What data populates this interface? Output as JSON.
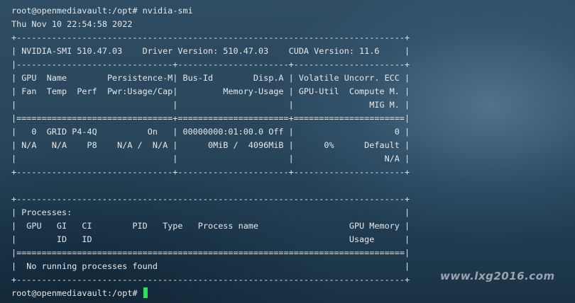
{
  "terminal": {
    "lines": [
      "root@openmediavault:/opt# nvidia-smi",
      "Thu Nov 10 22:54:58 2022",
      "+-----------------------------------------------------------------------------+",
      "| NVIDIA-SMI 510.47.03    Driver Version: 510.47.03    CUDA Version: 11.6     |",
      "|-------------------------------+----------------------+----------------------+",
      "| GPU  Name        Persistence-M| Bus-Id        Disp.A | Volatile Uncorr. ECC |",
      "| Fan  Temp  Perf  Pwr:Usage/Cap|         Memory-Usage | GPU-Util  Compute M. |",
      "|                               |                      |               MIG M. |",
      "|===============================+======================+======================|",
      "|   0  GRID P4-4Q          On   | 00000000:01:00.0 Off |                    0 |",
      "| N/A   N/A    P8    N/A /  N/A |      0MiB /  4096MiB |      0%      Default |",
      "|                               |                      |                  N/A |",
      "+-------------------------------+----------------------+----------------------+",
      "",
      "+-----------------------------------------------------------------------------+",
      "| Processes:                                                                  |",
      "|  GPU   GI   CI        PID   Type   Process name                  GPU Memory |",
      "|        ID   ID                                                   Usage      |",
      "|=============================================================================|",
      "|  No running processes found                                                 |",
      "+-----------------------------------------------------------------------------+"
    ],
    "prompt": "root@openmediavault:/opt# ",
    "cursor_color": "#2ee05a"
  },
  "watermark": "www.lxg2016.com"
}
